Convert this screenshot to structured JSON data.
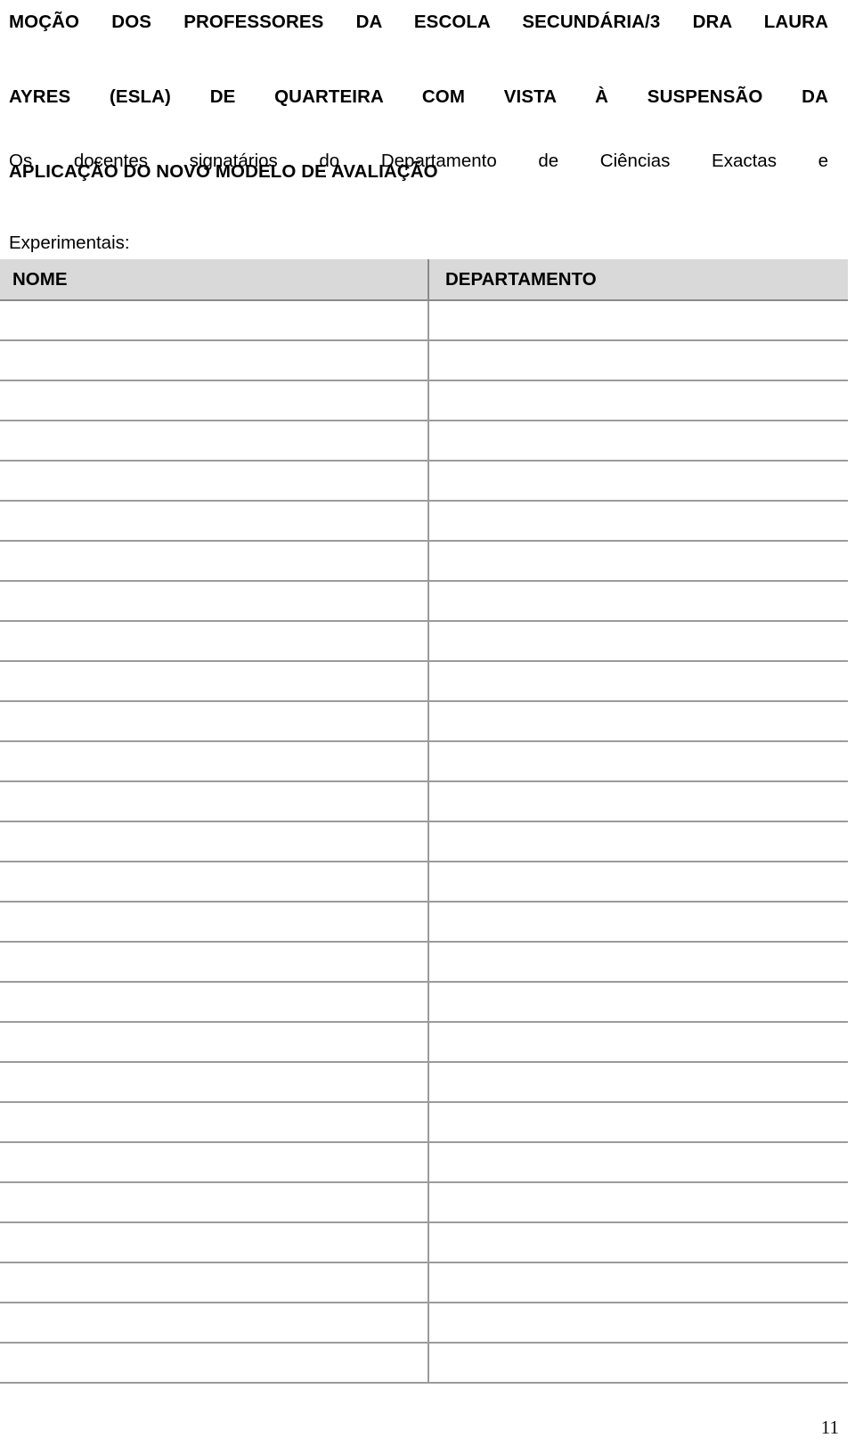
{
  "document": {
    "title_lines": [
      "MOÇÃO DOS PROFESSORES DA ESCOLA SECUNDÁRIA/3 DRA LAURA",
      "AYRES (ESLA) DE QUARTEIRA COM VISTA À SUSPENSÃO DA",
      "APLICAÇÃO DO NOVO MODELO DE AVALIAÇÃO"
    ],
    "intro_lines": [
      "Os docentes signatários do Departamento de Ciências Exactas e",
      "Experimentais:"
    ],
    "page_number": "11"
  },
  "signature_table": {
    "columns": [
      {
        "key": "nome",
        "label": "NOME"
      },
      {
        "key": "departamento",
        "label": "DEPARTAMENTO"
      }
    ],
    "header_background": "#d9d9d9",
    "rule_color": "#9b9b9b",
    "row_count": 27,
    "rows": [
      {
        "nome": "",
        "departamento": ""
      },
      {
        "nome": "",
        "departamento": ""
      },
      {
        "nome": "",
        "departamento": ""
      },
      {
        "nome": "",
        "departamento": ""
      },
      {
        "nome": "",
        "departamento": ""
      },
      {
        "nome": "",
        "departamento": ""
      },
      {
        "nome": "",
        "departamento": ""
      },
      {
        "nome": "",
        "departamento": ""
      },
      {
        "nome": "",
        "departamento": ""
      },
      {
        "nome": "",
        "departamento": ""
      },
      {
        "nome": "",
        "departamento": ""
      },
      {
        "nome": "",
        "departamento": ""
      },
      {
        "nome": "",
        "departamento": ""
      },
      {
        "nome": "",
        "departamento": ""
      },
      {
        "nome": "",
        "departamento": ""
      },
      {
        "nome": "",
        "departamento": ""
      },
      {
        "nome": "",
        "departamento": ""
      },
      {
        "nome": "",
        "departamento": ""
      },
      {
        "nome": "",
        "departamento": ""
      },
      {
        "nome": "",
        "departamento": ""
      },
      {
        "nome": "",
        "departamento": ""
      },
      {
        "nome": "",
        "departamento": ""
      },
      {
        "nome": "",
        "departamento": ""
      },
      {
        "nome": "",
        "departamento": ""
      },
      {
        "nome": "",
        "departamento": ""
      },
      {
        "nome": "",
        "departamento": ""
      },
      {
        "nome": "",
        "departamento": ""
      }
    ]
  }
}
